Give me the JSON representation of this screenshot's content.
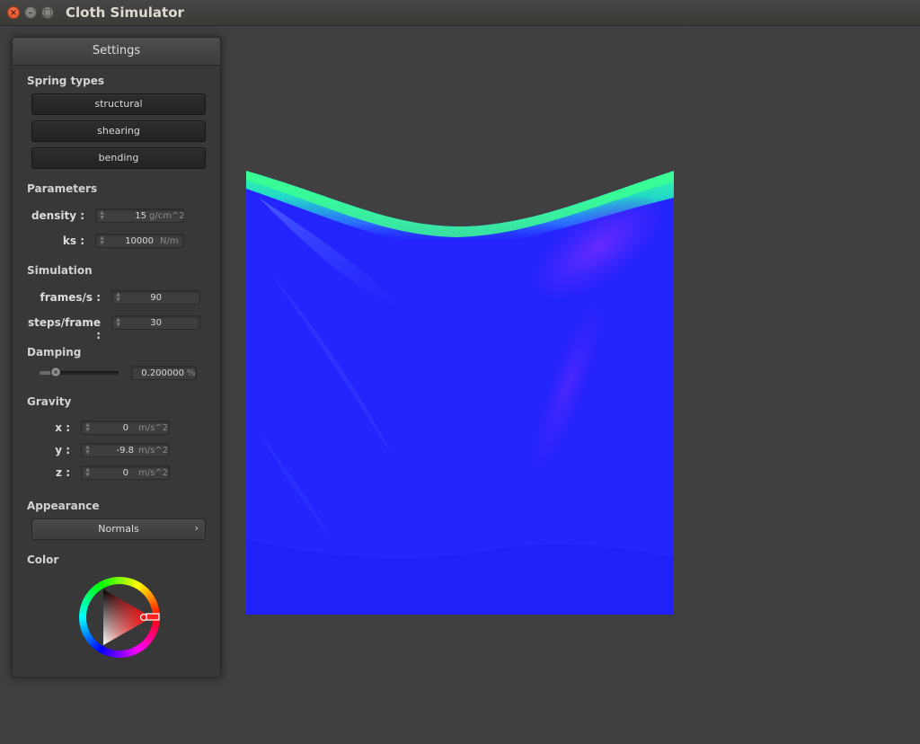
{
  "window": {
    "title": "Cloth Simulator",
    "close_glyph": "×",
    "minimize_glyph": "–",
    "maximize_glyph": "□"
  },
  "settings": {
    "title": "Settings",
    "spring_types": {
      "label": "Spring types",
      "buttons": [
        "structural",
        "shearing",
        "bending"
      ]
    },
    "parameters": {
      "label": "Parameters",
      "density": {
        "label": "density :",
        "value": "15",
        "unit": "g/cm^2"
      },
      "ks": {
        "label": "ks :",
        "value": "10000",
        "unit": "N/m"
      }
    },
    "simulation": {
      "label": "Simulation",
      "frames": {
        "label": "frames/s :",
        "value": "90"
      },
      "steps": {
        "label": "steps/frame :",
        "value": "30"
      }
    },
    "damping": {
      "label": "Damping",
      "value": "0.200000",
      "unit": "%",
      "slider_level": 0.2
    },
    "gravity": {
      "label": "Gravity",
      "x": {
        "label": "x :",
        "value": "0",
        "unit": "m/s^2"
      },
      "y": {
        "label": "y :",
        "value": "-9.8",
        "unit": "m/s^2"
      },
      "z": {
        "label": "z :",
        "value": "0",
        "unit": "m/s^2"
      }
    },
    "appearance": {
      "label": "Appearance",
      "selected": "Normals",
      "arrow_glyph": "›"
    },
    "color": {
      "label": "Color",
      "selected_hue": "#ff0000"
    }
  },
  "colors": {
    "background": "#404040",
    "cloth_main": "#2222ff",
    "cloth_highlight_top": "#2dff8a",
    "cloth_highlight_diag": "#6a2cff"
  },
  "icons": {
    "spinner": "updown-spinner-icon",
    "color_wheel": "color-wheel-icon"
  }
}
